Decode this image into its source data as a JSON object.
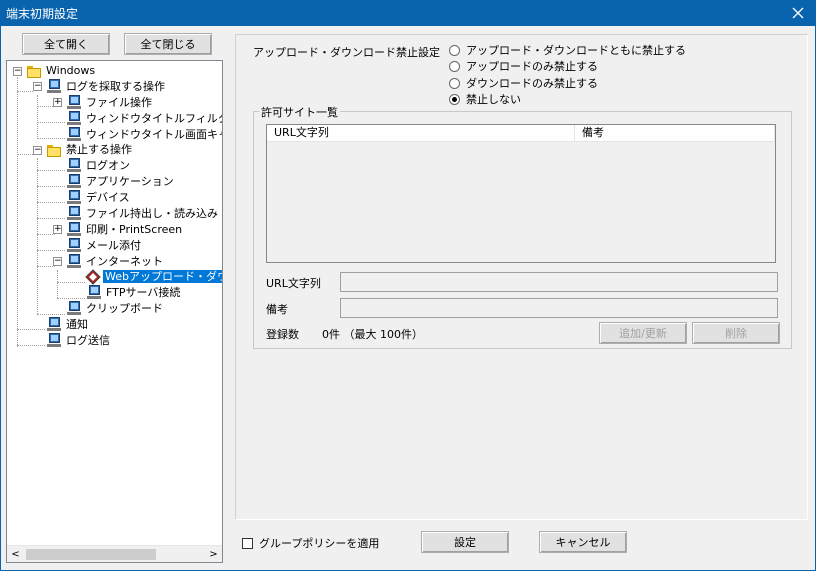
{
  "window": {
    "title": "端末初期設定",
    "close_icon": "close-icon"
  },
  "tree_buttons": {
    "expand_all": "全て開く",
    "collapse_all": "全て閉じる"
  },
  "tree": {
    "items": [
      {
        "label": "Windows",
        "icon": "folder-icon"
      },
      {
        "label": "ログを採取する操作",
        "icon": "computer-icon"
      },
      {
        "label": "ファイル操作",
        "icon": "computer-icon"
      },
      {
        "label": "ウィンドウタイトルフィルタ",
        "icon": "computer-icon"
      },
      {
        "label": "ウィンドウタイトル画面キャ",
        "icon": "computer-icon"
      },
      {
        "label": "禁止する操作",
        "icon": "folder-icon"
      },
      {
        "label": "ログオン",
        "icon": "computer-icon"
      },
      {
        "label": "アプリケーション",
        "icon": "computer-icon"
      },
      {
        "label": "デバイス",
        "icon": "computer-icon"
      },
      {
        "label": "ファイル持出し・読み込み",
        "icon": "computer-icon"
      },
      {
        "label": "印刷・PrintScreen",
        "icon": "computer-icon"
      },
      {
        "label": "メール添付",
        "icon": "computer-icon"
      },
      {
        "label": "インターネット",
        "icon": "computer-icon"
      },
      {
        "label": "Webアップロード・ダウン",
        "icon": "web-diamond-icon",
        "selected": true
      },
      {
        "label": "FTPサーバ接続",
        "icon": "computer-icon"
      },
      {
        "label": "クリップボード",
        "icon": "computer-icon"
      },
      {
        "label": "通知",
        "icon": "computer-icon"
      },
      {
        "label": "ログ送信",
        "icon": "computer-icon"
      }
    ],
    "expander_minus": "−",
    "expander_plus": "+"
  },
  "scrollbar": {
    "left_arrow": "<",
    "right_arrow": ">"
  },
  "settings": {
    "label": "アップロード・ダウンロード禁止設定",
    "options": [
      {
        "label": "アップロード・ダウンロードともに禁止する",
        "checked": false
      },
      {
        "label": "アップロードのみ禁止する",
        "checked": false
      },
      {
        "label": "ダウンロードのみ禁止する",
        "checked": false
      },
      {
        "label": "禁止しない",
        "checked": true
      }
    ]
  },
  "allowed_sites": {
    "title": "許可サイト一覧",
    "columns": [
      "URL文字列",
      "備考"
    ],
    "rows": [],
    "url_label": "URL文字列",
    "url_value": "",
    "remarks_label": "備考",
    "remarks_value": "",
    "count_label": "登録数",
    "count_value": "0件 （最大 100件）",
    "add_button": "追加/更新",
    "delete_button": "削除"
  },
  "footer": {
    "group_policy_label": "グループポリシーを適用",
    "group_policy_checked": false,
    "set_button": "設定",
    "cancel_button": "キャンセル"
  }
}
